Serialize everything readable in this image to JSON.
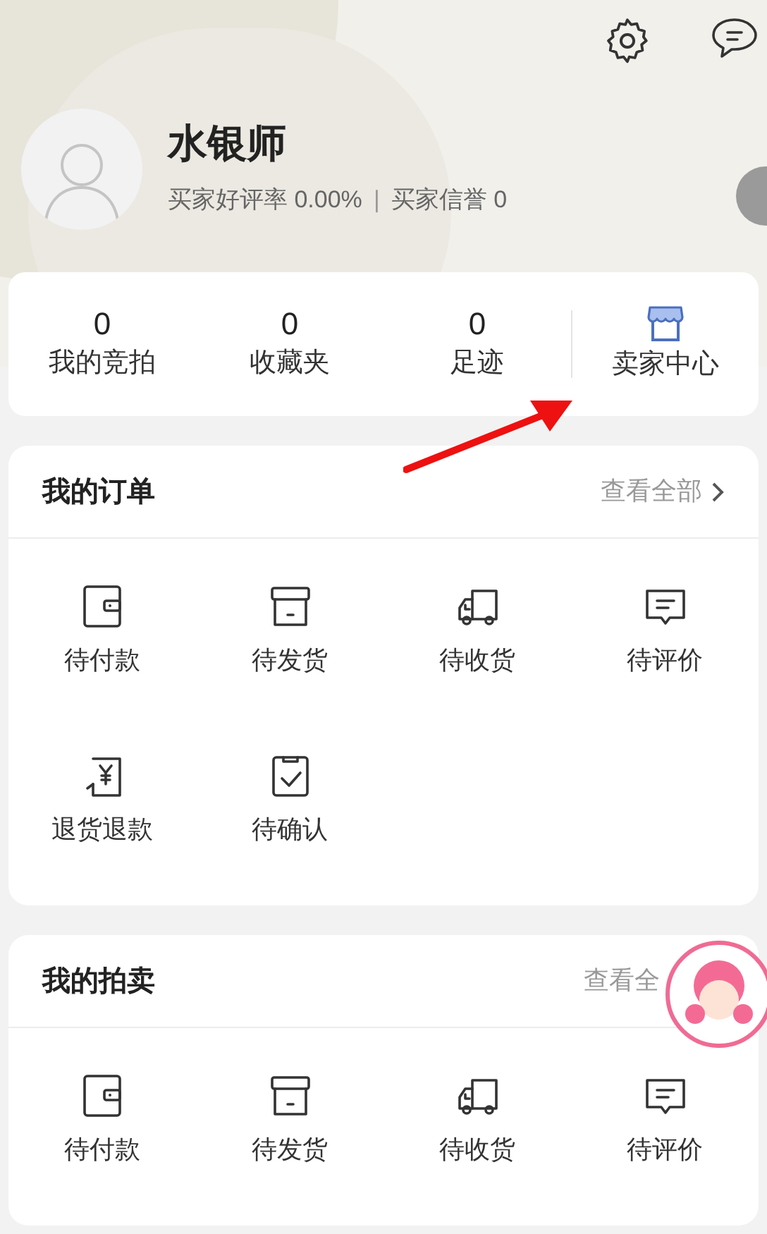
{
  "profile": {
    "name": "水银师",
    "rating": "买家好评率 0.00%",
    "separator": "|",
    "credit": "买家信誉 0"
  },
  "stats": [
    {
      "kind": "count",
      "value": "0",
      "label": "我的竞拍"
    },
    {
      "kind": "count",
      "value": "0",
      "label": "收藏夹"
    },
    {
      "kind": "count",
      "value": "0",
      "label": "足迹"
    },
    {
      "kind": "link",
      "label": "卖家中心"
    }
  ],
  "orders": {
    "title": "我的订单",
    "view_all": "查看全部",
    "items": [
      {
        "label": "待付款"
      },
      {
        "label": "待发货"
      },
      {
        "label": "待收货"
      },
      {
        "label": "待评价"
      },
      {
        "label": "退货退款"
      },
      {
        "label": "待确认"
      }
    ]
  },
  "auctions": {
    "title": "我的拍卖",
    "view_all": "查看全",
    "items": [
      {
        "label": "待付款"
      },
      {
        "label": "待发货"
      },
      {
        "label": "待收货"
      },
      {
        "label": "待评价"
      }
    ]
  }
}
